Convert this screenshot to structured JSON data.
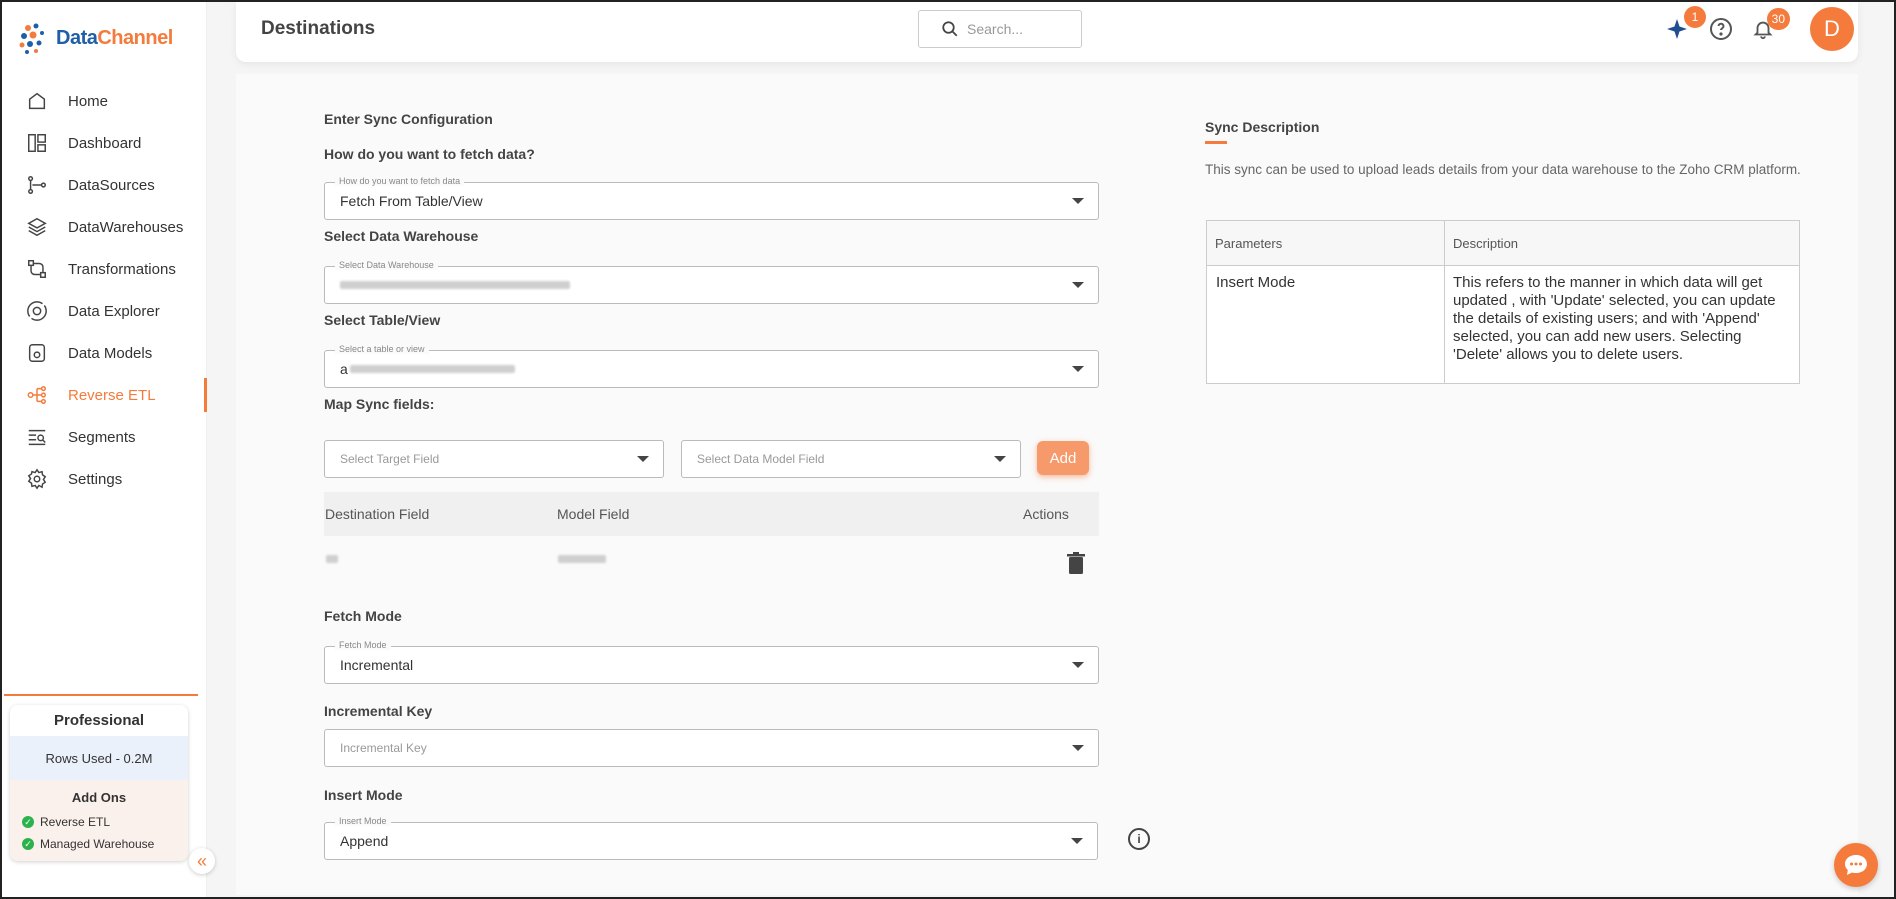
{
  "app": {
    "logo_text_1": "Data",
    "logo_text_2": "Channel"
  },
  "sidebar": {
    "items": [
      {
        "label": "Home",
        "icon": "home-icon"
      },
      {
        "label": "Dashboard",
        "icon": "dashboard-icon"
      },
      {
        "label": "DataSources",
        "icon": "datasources-icon"
      },
      {
        "label": "DataWarehouses",
        "icon": "datawarehouses-icon"
      },
      {
        "label": "Transformations",
        "icon": "transformations-icon"
      },
      {
        "label": "Data Explorer",
        "icon": "data-explorer-icon"
      },
      {
        "label": "Data Models",
        "icon": "data-models-icon"
      },
      {
        "label": "Reverse ETL",
        "icon": "reverse-etl-icon",
        "active": true
      },
      {
        "label": "Segments",
        "icon": "segments-icon"
      },
      {
        "label": "Settings",
        "icon": "settings-icon"
      }
    ],
    "plan": {
      "title": "Professional",
      "rows_used": "Rows Used - 0.2M",
      "addons_title": "Add Ons",
      "addons": [
        "Reverse ETL",
        "Managed Warehouse"
      ]
    }
  },
  "header": {
    "title": "Destinations",
    "search_placeholder": "Search...",
    "ai_badge": "1",
    "notification_badge": "30",
    "avatar_letter": "D"
  },
  "form": {
    "heading": "Enter Sync Configuration",
    "fetch_label": "How do you want to fetch data?",
    "fetch_float": "How do you want to fetch data",
    "fetch_value": "Fetch From Table/View",
    "warehouse_label": "Select Data Warehouse",
    "warehouse_float": "Select Data Warehouse",
    "table_label": "Select Table/View",
    "table_float": "Select a table or view",
    "table_value_prefix": "a",
    "map_label": "Map Sync fields:",
    "target_placeholder": "Select Target Field",
    "model_placeholder": "Select Data Model Field",
    "add_label": "Add",
    "map_columns": [
      "Destination Field",
      "Model Field",
      "Actions"
    ],
    "fetch_mode_label": "Fetch Mode",
    "fetch_mode_float": "Fetch Mode",
    "fetch_mode_value": "Incremental",
    "inc_key_label": "Incremental Key",
    "inc_key_placeholder": "Incremental Key",
    "insert_mode_label": "Insert Mode",
    "insert_mode_float": "Insert Mode",
    "insert_mode_value": "Append"
  },
  "description": {
    "title": "Sync Description",
    "text": "This sync can be used to upload leads details from your data warehouse to the Zoho CRM platform.",
    "table_headers": [
      "Parameters",
      "Description"
    ],
    "row_param": "Insert Mode",
    "row_desc": "This refers to the manner in which data will get updated , with 'Update' selected, you can update the details of existing users; and with 'Append' selected, you can add new users. Selecting 'Delete' allows you to delete users."
  },
  "colors": {
    "accent": "#f47b3b",
    "brand_blue": "#1f5fa8"
  }
}
